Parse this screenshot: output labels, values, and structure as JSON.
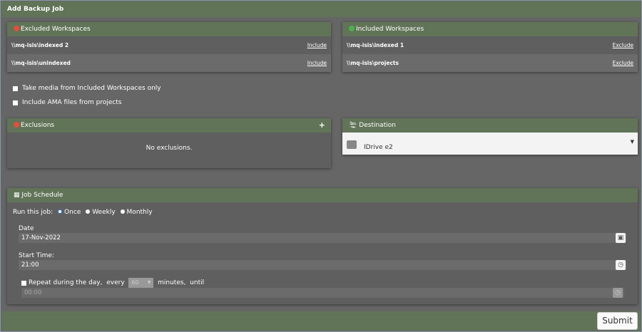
{
  "title": "Add Backup Job",
  "excluded": {
    "title": "Excluded Workspaces",
    "items": [
      {
        "path": "\\\\mq-isis\\indexed 2",
        "action": "Include"
      },
      {
        "path": "\\\\mq-isis\\unindexed",
        "action": "Include"
      }
    ]
  },
  "included": {
    "title": "Included Workspaces",
    "items": [
      {
        "path": "\\\\mq-isis\\indexed 1",
        "action": "Exclude"
      },
      {
        "path": "\\\\mq-isis\\projects",
        "action": "Exclude"
      }
    ]
  },
  "options": {
    "media_only": "Take media from Included Workspaces only",
    "ama": "Include AMA files from projects"
  },
  "exclusions": {
    "title": "Exclusions",
    "empty": "No exclusions.",
    "add": "+"
  },
  "destination": {
    "title": "Destination",
    "selected": "IDrive e2"
  },
  "schedule": {
    "title": "Job Schedule",
    "run_label": "Run this job:",
    "options": [
      "Once",
      "Weekly",
      "Monthly"
    ],
    "selected": "Once",
    "date_label": "Date",
    "date": "17-Nov-2022",
    "start_label": "Start Time:",
    "start": "21:00",
    "repeat_label": "Repeat during the day,",
    "every": "every",
    "minutes": "60",
    "minutes_label": "minutes,",
    "until": "until",
    "until_value": "00:00"
  },
  "submit": "Submit",
  "colors": {
    "header": "#617458",
    "background": "#666666",
    "excluded": "#e84c3d",
    "included": "#4caf50",
    "selected_radio": "#2f80ed"
  }
}
